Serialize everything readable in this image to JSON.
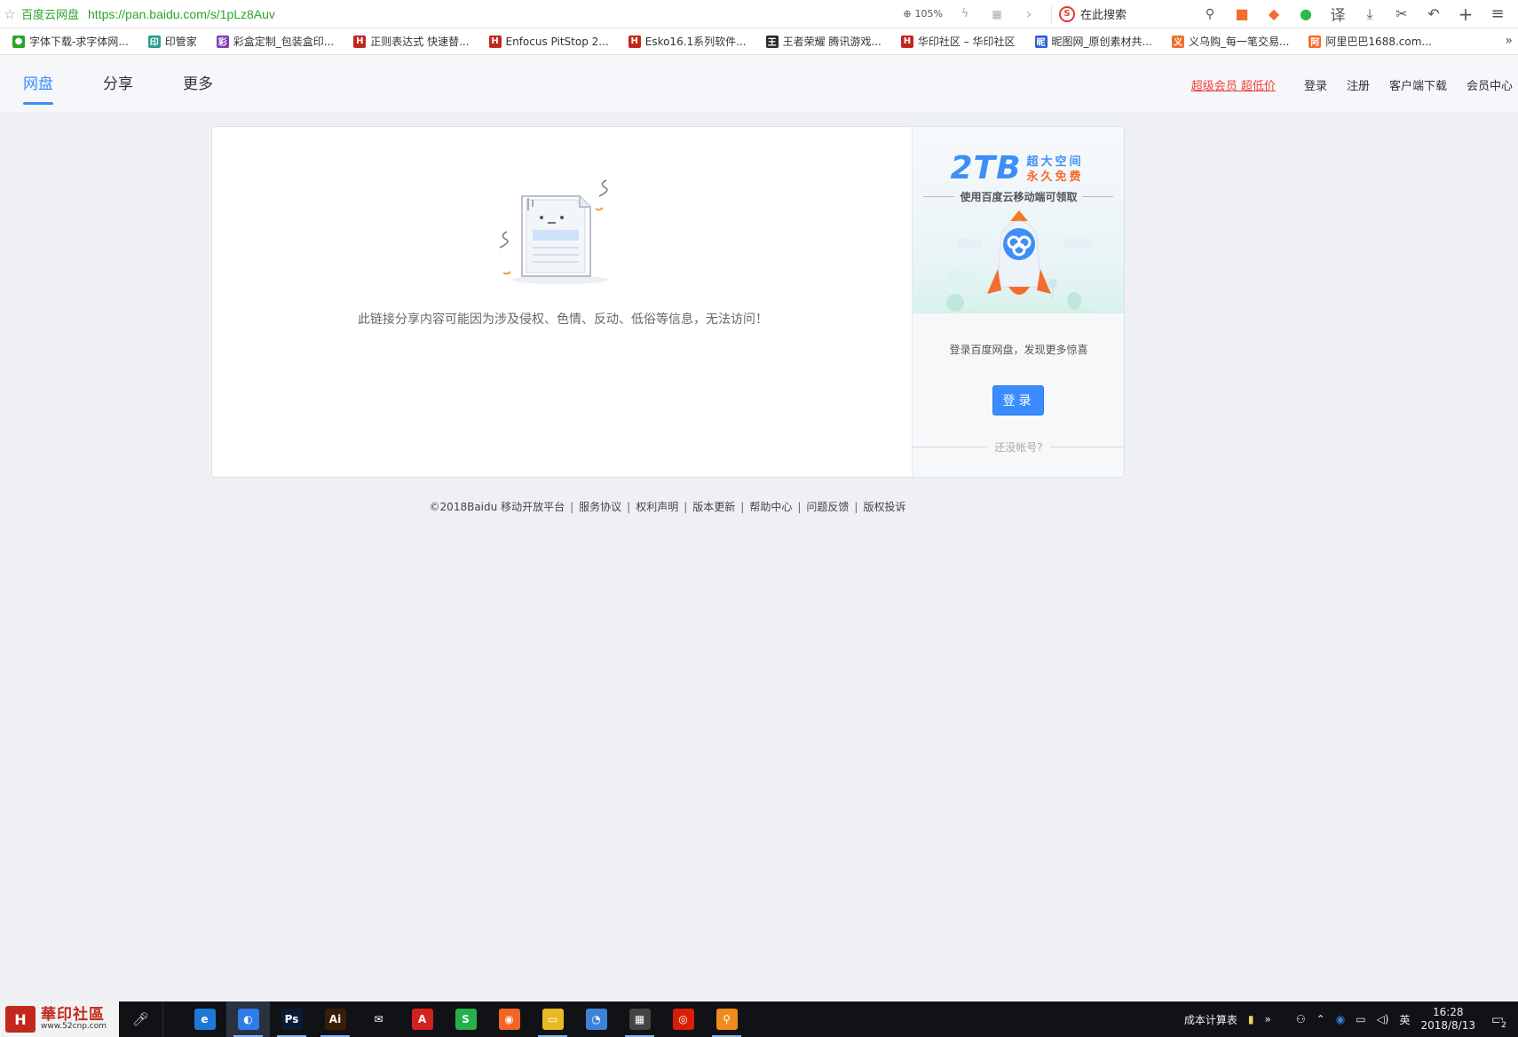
{
  "browser": {
    "site_title": "百度云网盘",
    "url": "https://pan.baidu.com/s/1pLz8Auv",
    "zoom": "105%",
    "search_placeholder": "在此搜索",
    "translate_label": "译"
  },
  "bookmarks": [
    {
      "label": "字体下载-求字体网...",
      "color": "#2aa52a",
      "glyph": "●"
    },
    {
      "label": "印管家",
      "color": "#2a9d8f",
      "glyph": "印"
    },
    {
      "label": "彩盒定制_包装盒印...",
      "color": "#7b3fb5",
      "glyph": "彩"
    },
    {
      "label": "正则表达式 快速替...",
      "color": "#c2281d",
      "glyph": "H"
    },
    {
      "label": "Enfocus PitStop 2...",
      "color": "#c2281d",
      "glyph": "H"
    },
    {
      "label": "Esko16.1系列软件...",
      "color": "#c2281d",
      "glyph": "H"
    },
    {
      "label": "王者荣耀 腾讯游戏...",
      "color": "#2b2b2b",
      "glyph": "王"
    },
    {
      "label": "华印社区 – 华印社区",
      "color": "#c2281d",
      "glyph": "H"
    },
    {
      "label": "昵图网_原创素材共...",
      "color": "#2f5fd0",
      "glyph": "昵"
    },
    {
      "label": "义乌购_每一笔交易...",
      "color": "#f46d2f",
      "glyph": "义"
    },
    {
      "label": "阿里巴巴1688.com...",
      "color": "#f46d2f",
      "glyph": "阿"
    }
  ],
  "header": {
    "tabs": [
      {
        "label": "网盘",
        "active": true
      },
      {
        "label": "分享",
        "active": false
      },
      {
        "label": "更多",
        "active": false
      }
    ],
    "promo_link": "超级会员 超低价",
    "login": "登录",
    "register": "注册",
    "client_download": "客户端下载",
    "member_center": "会员中心"
  },
  "main": {
    "blocked_message": "此链接分享内容可能因为涉及侵权、色情、反动、低俗等信息，无法访问！"
  },
  "sidebar": {
    "banner_big": "2TB",
    "banner_line1": "超大空间",
    "banner_line2": "永久免费",
    "banner_caption": "使用百度云移动端可领取",
    "login_hint": "登录百度网盘，发现更多惊喜",
    "login_button": "登录",
    "no_account": "还没帐号?"
  },
  "footer": {
    "copyright": "©2018Baidu",
    "links": [
      "移动开放平台",
      "服务协议",
      "权利声明",
      "版本更新",
      "帮助中心",
      "问题反馈",
      "版权投诉"
    ]
  },
  "taskbar": {
    "logo_cn": "華印社區",
    "logo_en": "www.52cnp.com",
    "apps": [
      {
        "name": "edge",
        "glyph": "e",
        "color": "#1e78d7"
      },
      {
        "name": "browser-360",
        "glyph": "◐",
        "color": "#2f7be9"
      },
      {
        "name": "photoshop",
        "glyph": "Ps",
        "color": "#0b1b33"
      },
      {
        "name": "illustrator",
        "glyph": "Ai",
        "color": "#3a1d06"
      },
      {
        "name": "mail",
        "glyph": "✉",
        "color": "#101216"
      },
      {
        "name": "acrobat",
        "glyph": "A",
        "color": "#d3211d"
      },
      {
        "name": "wps",
        "glyph": "S",
        "color": "#25b04b"
      },
      {
        "name": "orange-app",
        "glyph": "◉",
        "color": "#f26522"
      },
      {
        "name": "file-explorer",
        "glyph": "▭",
        "color": "#e8b923"
      },
      {
        "name": "blue-app",
        "glyph": "◔",
        "color": "#3d82d8"
      },
      {
        "name": "calculator",
        "glyph": "▦",
        "color": "#444"
      },
      {
        "name": "netease-music",
        "glyph": "◎",
        "color": "#d81e06"
      },
      {
        "name": "search-tool",
        "glyph": "⚲",
        "color": "#f08a1c"
      }
    ],
    "tray_text": "成本计算表",
    "ime": "英",
    "time": "16:28",
    "date": "2018/8/13",
    "notifications": "2"
  }
}
